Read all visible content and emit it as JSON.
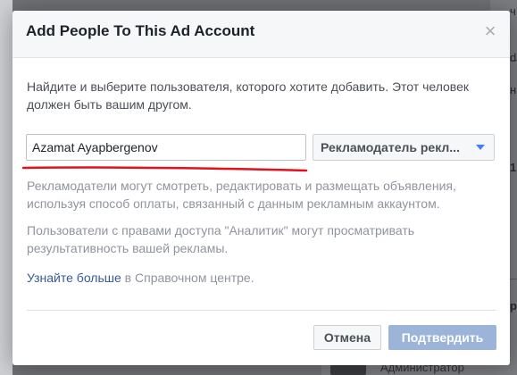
{
  "background": {
    "right_fragments": [
      "ч",
      "ds",
      "н",
      "1",
      "рка"
    ],
    "bottom_text": "Администратор"
  },
  "dialog": {
    "title": "Add People To This Ad Account",
    "close_glyph": "×",
    "instructions": "Найдите и выберите пользователя, которого хотите добавить. Этот человек должен быть вашим другом.",
    "name_input": {
      "value": "Azamat Ayapbergenov",
      "placeholder": ""
    },
    "role_select": {
      "selected": "Рекламодатель рекл..."
    },
    "description_advertisers": "Рекламодатели могут смотреть, редактировать и размещать объявления, используя способ оплаты, связанный с данным рекламным аккаунтом.",
    "description_analysts": "Пользователи с правами доступа \"Аналитик\" могут просматривать результативность вашей рекламы.",
    "help": {
      "link_text": "Узнайте больше",
      "suffix": " в Справочном центре."
    },
    "buttons": {
      "cancel": "Отмена",
      "confirm": "Подтвердить"
    }
  },
  "colors": {
    "link": "#365899",
    "confirm_disabled": "#9cb4d8",
    "underline_annotation": "#e3101d",
    "dropdown_caret": "#4080ff"
  }
}
